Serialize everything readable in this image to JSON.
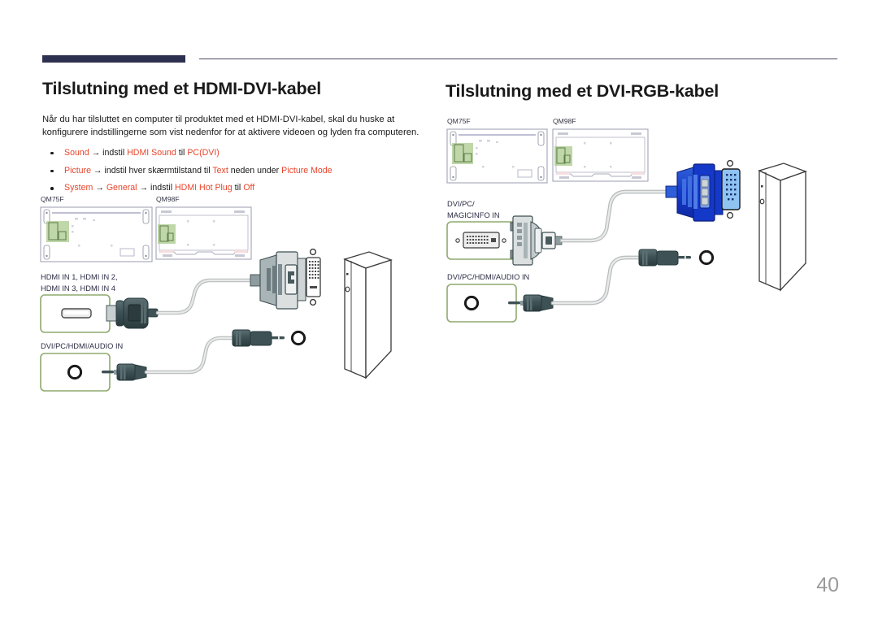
{
  "page": {
    "number": "40",
    "accent_bar_color": "#2e3050",
    "highlight_color": "#e8452c",
    "port_box_border_color": "#8faa6e",
    "text_color": "#1a1a1a"
  },
  "left_column": {
    "title": "Tilslutning med et HDMI-DVI-kabel",
    "intro": "Når du har tilsluttet en computer til produktet med et HDMI-DVI-kabel, skal du huske at konfigurere indstillingerne som vist nedenfor for at aktivere videoen og lyden fra computeren.",
    "bullets": [
      {
        "parts": [
          {
            "text": "Sound",
            "style": "hl"
          },
          {
            "text": " → ",
            "style": "plain"
          },
          {
            "text": "indstil ",
            "style": "plain"
          },
          {
            "text": "HDMI Sound",
            "style": "hl"
          },
          {
            "text": " til ",
            "style": "plain"
          },
          {
            "text": "PC(DVI)",
            "style": "hl"
          }
        ]
      },
      {
        "parts": [
          {
            "text": "Picture",
            "style": "hl"
          },
          {
            "text": " → ",
            "style": "plain"
          },
          {
            "text": "indstil hver skærmtilstand til ",
            "style": "plain"
          },
          {
            "text": "Text",
            "style": "hl"
          },
          {
            "text": " neden under ",
            "style": "plain"
          },
          {
            "text": "Picture Mode",
            "style": "hl"
          }
        ]
      },
      {
        "parts": [
          {
            "text": "System",
            "style": "hl"
          },
          {
            "text": " → ",
            "style": "plain"
          },
          {
            "text": "General",
            "style": "hl"
          },
          {
            "text": " → ",
            "style": "plain"
          },
          {
            "text": "indstil ",
            "style": "plain"
          },
          {
            "text": "HDMI Hot Plug",
            "style": "hl"
          },
          {
            "text": " til ",
            "style": "plain"
          },
          {
            "text": "Off",
            "style": "hl"
          }
        ]
      }
    ],
    "diagram": {
      "model_labels": [
        "QM75F",
        "QM98F"
      ],
      "port_label_video_line1": "HDMI IN 1, HDMI IN 2,",
      "port_label_video_line2": "HDMI IN 3, HDMI IN 4",
      "port_label_audio": "DVI/PC/HDMI/AUDIO IN",
      "video_connector": "hdmi-to-dvi-cable",
      "audio_connector": "stereo-mini-jack-cable",
      "device": "desktop-pc-tower"
    }
  },
  "right_column": {
    "title": "Tilslutning med et DVI-RGB-kabel",
    "diagram": {
      "model_labels": [
        "QM75F",
        "QM98F"
      ],
      "port_label_video_line1": "DVI/PC/",
      "port_label_video_line2": "MAGICINFO IN",
      "port_label_audio": "DVI/PC/HDMI/AUDIO IN",
      "video_connector": "dvi-to-rgb-vga-cable",
      "audio_connector": "stereo-mini-jack-cable",
      "device": "desktop-pc-tower"
    }
  }
}
